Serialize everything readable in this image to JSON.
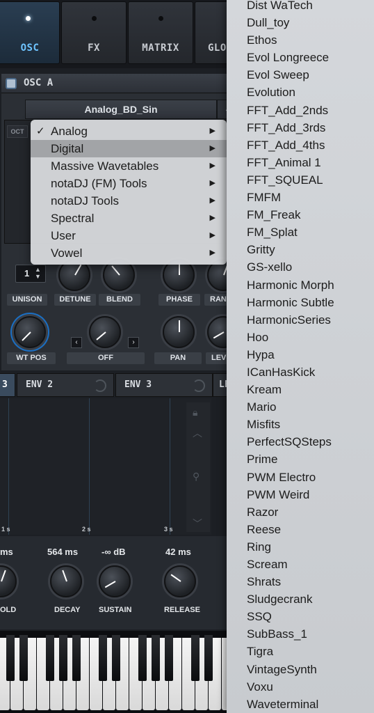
{
  "tabs": [
    {
      "label": "OSC",
      "active": true
    },
    {
      "label": "FX",
      "active": false
    },
    {
      "label": "MATRIX",
      "active": false
    },
    {
      "label": "GLO",
      "active": false
    }
  ],
  "osc": {
    "title": "OSC  A",
    "wavetable_name": "Analog_BD_Sin",
    "prev_glyph": "‹",
    "oct_label": "OCT",
    "unison_value": "1",
    "unison_arrows": "▲▼",
    "knob_labels": {
      "unison": "UNISON",
      "detune": "DETUNE",
      "blend": "BLEND",
      "phase": "PHASE",
      "rand": "RAN",
      "wt_pos": "WT POS",
      "off": "OFF",
      "pan": "PAN",
      "level": "LEV"
    },
    "arrow_left": "‹",
    "arrow_right": "›"
  },
  "envelopes": {
    "tabs": [
      {
        "label": "3",
        "active": true
      },
      {
        "label": "ENV 2",
        "active": false
      },
      {
        "label": "ENV 3",
        "active": false
      },
      {
        "label": "LF",
        "active": false
      }
    ],
    "times": [
      "1 s",
      "2 s",
      "3 s"
    ],
    "values": {
      "hold": "ms",
      "decay": "564 ms",
      "sustain": "-∞ dB",
      "release": "42 ms"
    },
    "labels": {
      "hold": "OLD",
      "decay": "DECAY",
      "sustain": "SUSTAIN",
      "release": "RELEASE"
    }
  },
  "category_menu": {
    "items": [
      {
        "label": "Analog",
        "checked": true,
        "highlighted": false
      },
      {
        "label": "Digital",
        "checked": false,
        "highlighted": true
      },
      {
        "label": "Massive Wavetables",
        "checked": false,
        "highlighted": false
      },
      {
        "label": "notaDJ (FM) Tools",
        "checked": false,
        "highlighted": false
      },
      {
        "label": "notaDJ Tools",
        "checked": false,
        "highlighted": false
      },
      {
        "label": "Spectral",
        "checked": false,
        "highlighted": false
      },
      {
        "label": "User",
        "checked": false,
        "highlighted": false
      },
      {
        "label": "Vowel",
        "checked": false,
        "highlighted": false
      }
    ],
    "check_glyph": "✓",
    "submenu_glyph": "▶"
  },
  "wavetable_menu": {
    "items": [
      "Dist WaTech",
      "Dull_toy",
      "Ethos",
      "Evol Longreece",
      "Evol Sweep",
      "Evolution",
      "FFT_Add_2nds",
      "FFT_Add_3rds",
      "FFT_Add_4ths",
      "FFT_Animal 1",
      "FFT_SQUEAL",
      "FMFM",
      "FM_Freak",
      "FM_Splat",
      "Gritty",
      "GS-xello",
      "Harmonic Morph",
      "Harmonic Subtle",
      "HarmonicSeries",
      "Hoo",
      "Hypa",
      "ICanHasKick",
      "Kream",
      "Mario",
      "Misfits",
      "PerfectSQSteps",
      "Prime",
      "PWM Electro",
      "PWM Weird",
      "Razor",
      "Reese",
      "Ring",
      "Scream",
      "Shrats",
      "Sludgecrank",
      "SSQ",
      "SubBass_1",
      "Tigra",
      "VintageSynth",
      "Voxu",
      "Waveterminal"
    ]
  }
}
